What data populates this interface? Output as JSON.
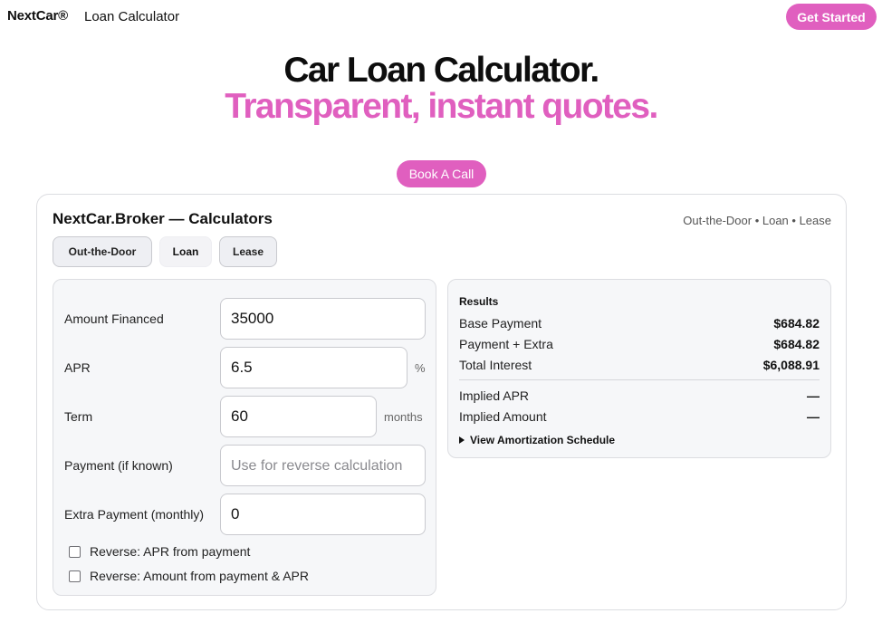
{
  "header": {
    "brand": "NextCar®",
    "section": "Loan Calculator",
    "cta_label": "Get Started"
  },
  "hero": {
    "title": "Car Loan Calculator.",
    "subtitle": "Transparent, instant quotes.",
    "book_call_label": "Book A Call"
  },
  "colors": {
    "accent": "#e05fbf",
    "panel_bg": "#f6f7f9",
    "border": "#dcdde1"
  },
  "card": {
    "title": "NextCar.Broker — Calculators",
    "crumb": "Out-the-Door • Loan • Lease",
    "tabs": [
      {
        "label": "Out-the-Door",
        "active": false
      },
      {
        "label": "Loan",
        "active": true
      },
      {
        "label": "Lease",
        "active": false
      }
    ]
  },
  "form": {
    "amount_financed": {
      "label": "Amount Financed",
      "value": "35000"
    },
    "apr": {
      "label": "APR",
      "value": "6.5",
      "unit": "%"
    },
    "term": {
      "label": "Term",
      "value": "60",
      "unit": "months"
    },
    "payment": {
      "label": "Payment (if known)",
      "value": "",
      "placeholder": "Use for reverse calculation"
    },
    "extra_payment": {
      "label": "Extra Payment (monthly)",
      "value": "0"
    },
    "reverse_apr": {
      "label": "Reverse: APR from payment",
      "checked": false
    },
    "reverse_amount": {
      "label": "Reverse: Amount from payment & APR",
      "checked": false
    }
  },
  "results": {
    "heading": "Results",
    "rows": [
      {
        "label": "Base Payment",
        "value": "$684.82"
      },
      {
        "label": "Payment + Extra",
        "value": "$684.82"
      },
      {
        "label": "Total Interest",
        "value": "$6,088.91"
      },
      {
        "label": "Implied APR",
        "value": "—"
      },
      {
        "label": "Implied Amount",
        "value": "—"
      }
    ],
    "amortization_label": "View Amortization Schedule"
  }
}
